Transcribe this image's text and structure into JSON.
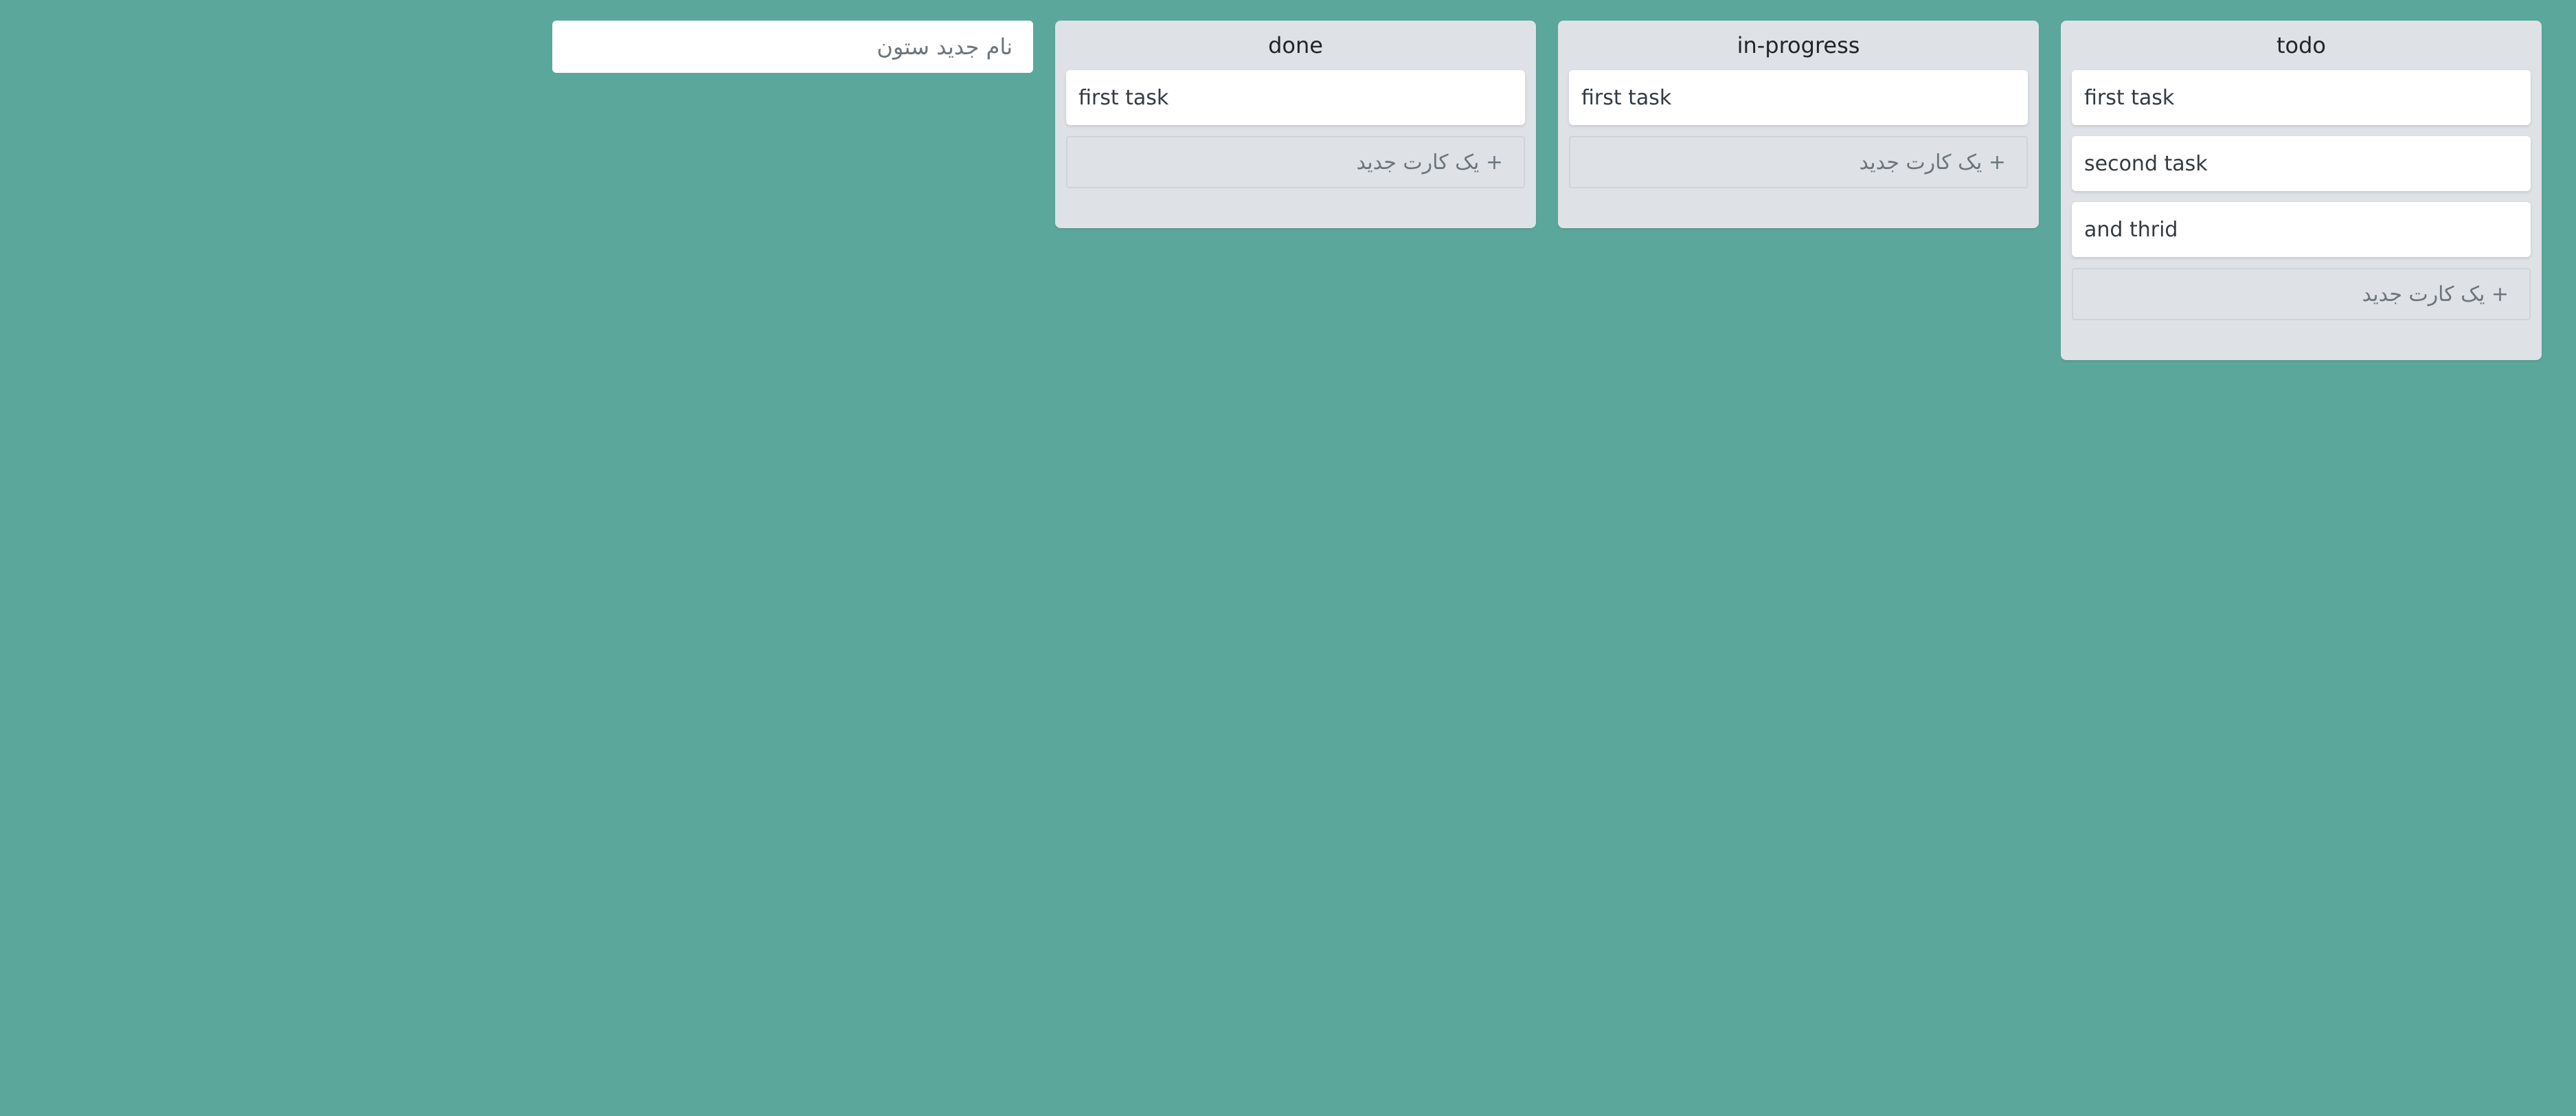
{
  "board": {
    "new_column_placeholder": "نام جدید ستون",
    "add_card_label": "+ یک کارت جدید",
    "columns": [
      {
        "title": "todo",
        "cards": [
          "first task",
          "second task",
          "and thrid"
        ]
      },
      {
        "title": "in-progress",
        "cards": [
          "first task"
        ]
      },
      {
        "title": "done",
        "cards": [
          "first task"
        ]
      }
    ]
  },
  "colors": {
    "background": "#5ba79b",
    "column_bg": "#dee2e6",
    "card_bg": "#ffffff"
  }
}
